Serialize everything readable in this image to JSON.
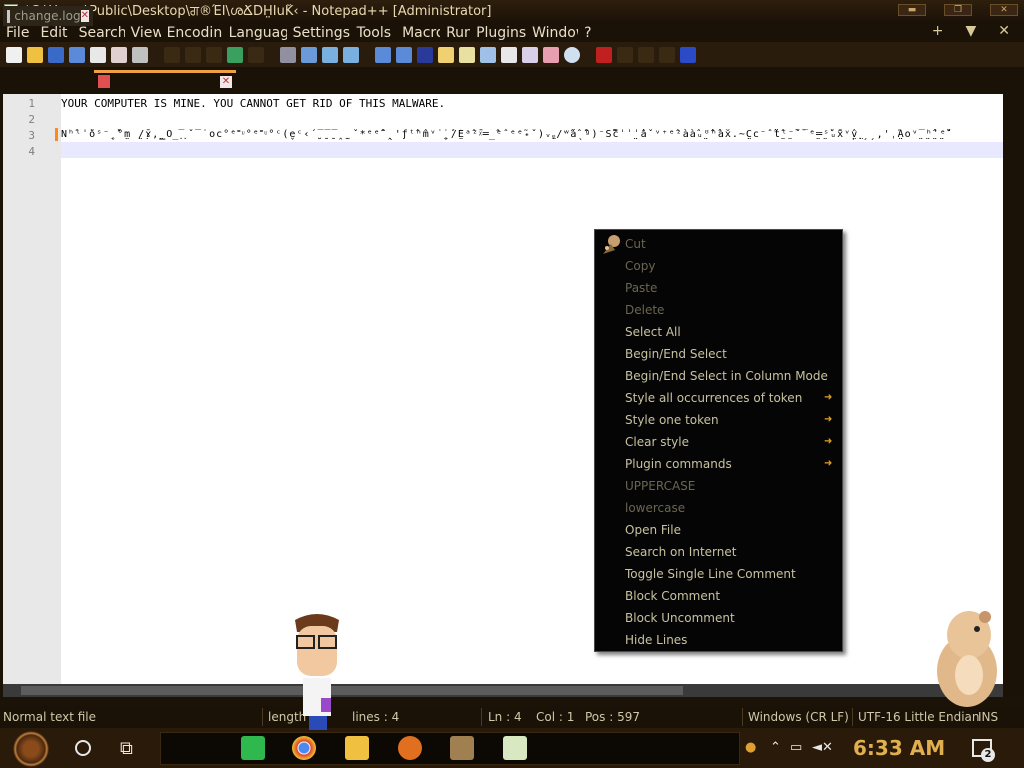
{
  "window": {
    "title": "*C:\\Users\\Public\\Desktop\\ਗ®ΈΙ\\ശՃD̐H̤IuK̊‹ - Notepad++ [Administrator]",
    "buttons": [
      "minimize",
      "restore",
      "close"
    ]
  },
  "menu": {
    "items": [
      "File",
      "Edit",
      "Search",
      "View",
      "Encoding",
      "Language",
      "Settings",
      "Tools",
      "Macro",
      "Run",
      "Plugins",
      "Window",
      "?"
    ],
    "right": [
      "+",
      "▼",
      "✕"
    ]
  },
  "toolbar_icons": [
    "new-file-icon",
    "open-file-icon",
    "save-icon",
    "save-all-icon",
    "close-icon",
    "close-all-icon",
    "print-icon",
    "cut-icon",
    "copy-icon",
    "paste-icon",
    "undo-icon",
    "redo-icon",
    "find-icon",
    "replace-icon",
    "zoom-in-icon",
    "zoom-out-icon",
    "sync-v-icon",
    "sync-h-icon",
    "wrap-icon",
    "all-chars-icon",
    "indent-guide-icon",
    "udl-icon",
    "doc-map-icon",
    "func-list-icon",
    "folder-icon",
    "monitor-icon",
    "record-icon",
    "run-macro-icon"
  ],
  "tabs": [
    {
      "label": "change.log"
    },
    {
      "label": ""
    }
  ],
  "editor": {
    "line_numbers": [
      "1",
      "2",
      "3",
      "4"
    ],
    "lines": [
      "YOUR COMPUTER IS MINE. YOU CANNOT GET RID OF THIS MALWARE.",
      "",
      "N̂ʰ̂ˡˈo̊ˢ⁻̣˳̊°m̤ ̤/̣ɤ̄,̤‗O̲̅˯˯ˇ‾˙oc°ᵉ˭ᶸ°ᵉ˭ᶸ°ᶜ(e̬ᶜ‹´̮‾̱‾̱‾̭ ̫ ˇ*ᵉᵉ̂ˆ̭ˎ'ƒ̀̄ᵗ̂ʰm̂ᵛ˙̤̥̇ ́̇/É̤ᵃ̂ᶻ̄ᵡ═̲̂ᵉˆᵉᵉ̃˖ˇ)ᵥ̤ᵩ/ʷ̂á̂ˎ̂̃ᶢ)⁻Š̄̂c̈̂̃ˈˈ̤ˈa̍̂ˇᵛ⁺ᵉ̂ᶻàà̂ᵤ̤ᶷ̂̂ʰ̂àx̆.~C̤c⁻ˆ̃ẗ̤̂ᵗ̤⁻̄ˇ̄‾ᵉ̤═̤ˢ̊ᵤx̃̂ᵛ̩v̤̂˰̤ˏˏ,'ˌ̃Á̤oᵛ̤‾̤ʰ̤̂̂ˈ̤ᵉ̊̊̊",
      ""
    ]
  },
  "context_menu": {
    "items": [
      {
        "label": "Cut",
        "disabled": true
      },
      {
        "label": "Copy",
        "disabled": true
      },
      {
        "label": "Paste",
        "disabled": true
      },
      {
        "label": "Delete",
        "disabled": true
      },
      {
        "label": "Select All"
      },
      {
        "label": "Begin/End Select"
      },
      {
        "label": "Begin/End Select in Column Mode"
      },
      {
        "label": "Style all occurrences of token",
        "submenu": true
      },
      {
        "label": "Style one token",
        "submenu": true
      },
      {
        "label": "Clear style",
        "submenu": true
      },
      {
        "label": "Plugin commands",
        "submenu": true
      },
      {
        "label": "UPPERCASE",
        "disabled": true
      },
      {
        "label": "lowercase",
        "disabled": true
      },
      {
        "label": "Open File"
      },
      {
        "label": "Search on Internet"
      },
      {
        "label": "Toggle Single Line Comment"
      },
      {
        "label": "Block Comment"
      },
      {
        "label": "Block Uncomment"
      },
      {
        "label": "Hide Lines"
      }
    ]
  },
  "status": {
    "file_type": "Normal text file",
    "length": "length",
    "lines": "lines : 4",
    "ln": "Ln : 4",
    "col": "Col : 1",
    "pos": "Pos : 597",
    "eol": "Windows (CR LF)",
    "encoding": "UTF-16 Little Endian",
    "mode": "INS"
  },
  "taskbar": {
    "apps": [
      "messages-app-icon",
      "chrome-app-icon",
      "explorer-app-icon",
      "search-app-icon",
      "game-app-icon",
      "notepad-app-icon"
    ],
    "clock": "6:33 AM",
    "notification_count": "2"
  },
  "colors": {
    "accent": "#f0a040",
    "menu_bg": "#050505",
    "menu_text": "#c8c2a0",
    "clock": "#e0b050"
  }
}
